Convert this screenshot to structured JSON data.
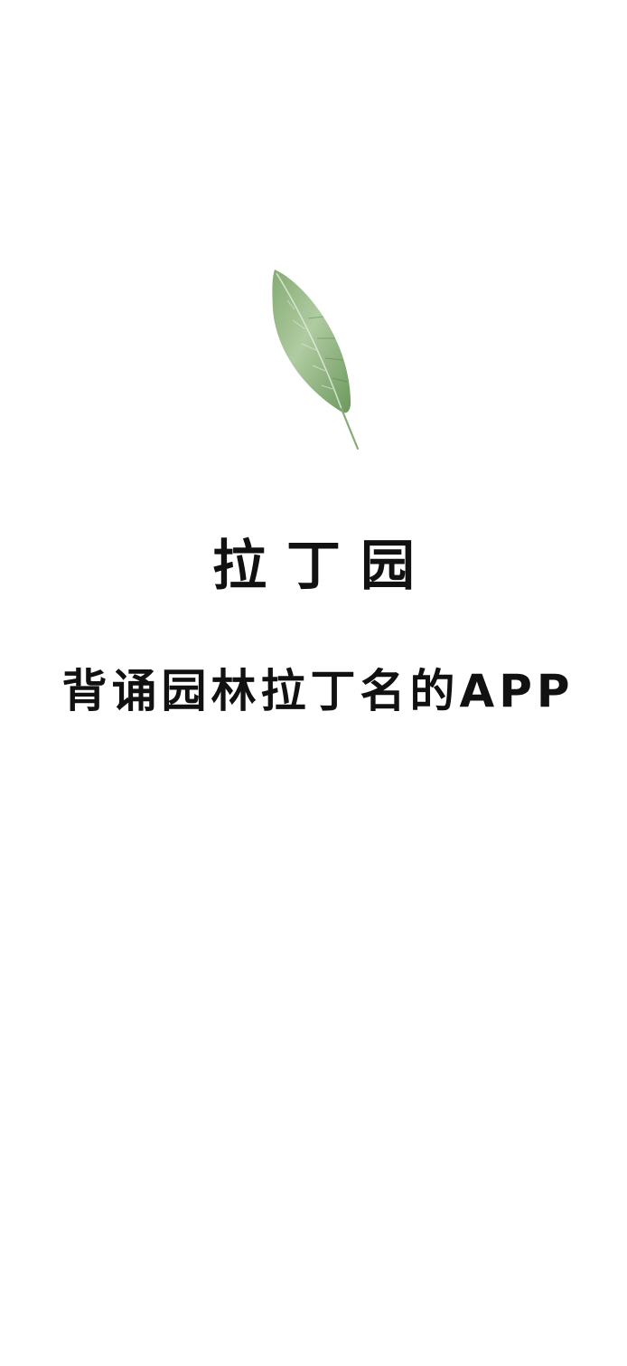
{
  "splash": {
    "app_name": "拉丁园",
    "tagline": "背诵园林拉丁名的APP",
    "logo_icon": "leaf-icon"
  },
  "colors": {
    "background": "#ffffff",
    "text": "#111111",
    "leaf_dark": "#5f8f4e",
    "leaf_light": "#a9c79a"
  }
}
